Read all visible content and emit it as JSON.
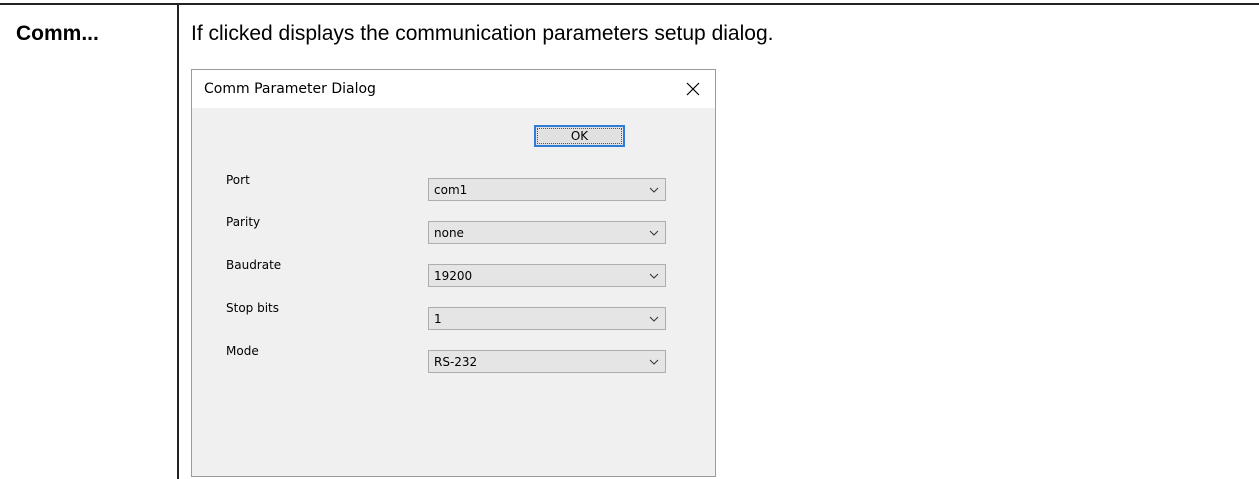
{
  "row": {
    "term": "Comm...",
    "description": "If clicked displays the communication parameters setup dialog."
  },
  "dialog": {
    "title": "Comm Parameter Dialog",
    "ok_label": "OK",
    "fields": [
      {
        "label": "Port",
        "value": "com1"
      },
      {
        "label": "Parity",
        "value": "none"
      },
      {
        "label": "Baudrate",
        "value": "19200"
      },
      {
        "label": "Stop bits",
        "value": "1"
      },
      {
        "label": "Mode",
        "value": "RS-232"
      }
    ]
  },
  "icons": {
    "close": "close-icon",
    "dropdown": "chevron-down-icon"
  }
}
